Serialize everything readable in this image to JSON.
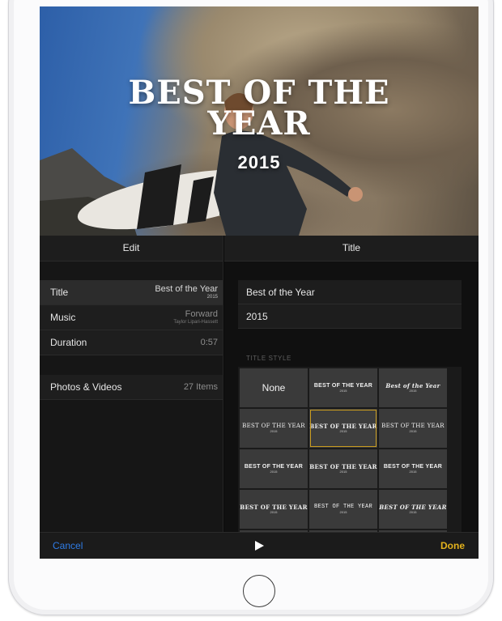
{
  "hero": {
    "title_line1": "BEST OF THE",
    "title_line2": "YEAR",
    "year": "2015"
  },
  "edit_panel": {
    "header": "Edit",
    "rows": [
      {
        "label": "Title",
        "value": "Best of the Year",
        "sub": "2015"
      },
      {
        "label": "Music",
        "value": "Forward",
        "sub": "Taylor Lipari-Hassett"
      },
      {
        "label": "Duration",
        "value": "0:57"
      }
    ],
    "photos": {
      "label": "Photos & Videos",
      "value": "27 Items"
    }
  },
  "title_panel": {
    "header": "Title",
    "title_field": "Best of the Year",
    "subtitle_field": "2015",
    "style_section_label": "TITLE STYLE",
    "styles": [
      {
        "line1": "None",
        "line2": ""
      },
      {
        "line1": "BEST OF THE YEAR",
        "line2": "2015"
      },
      {
        "line1": "Best of the Year",
        "line2": "2015"
      },
      {
        "line1": "BEST OF THE YEAR",
        "line2": "2015"
      },
      {
        "line1": "BEST OF THE YEAR",
        "line2": "2015"
      },
      {
        "line1": "BEST OF THE YEAR",
        "line2": "2015"
      },
      {
        "line1": "BEST OF THE YEAR",
        "line2": "2015"
      },
      {
        "line1": "BEST OF THE YEAR",
        "line2": "2015"
      },
      {
        "line1": "BEST OF THE YEAR",
        "line2": "2015"
      },
      {
        "line1": "BEST OF THE YEAR",
        "line2": "2015"
      },
      {
        "line1": "BEST OF THE YEAR",
        "line2": "2015"
      },
      {
        "line1": "BEST OF THE YEAR",
        "line2": "2015"
      }
    ]
  },
  "toolbar": {
    "cancel": "Cancel",
    "done": "Done",
    "play_icon": "play-icon"
  },
  "colors": {
    "accent_blue": "#2f7ce6",
    "accent_yellow": "#e3b21c",
    "selection_outline": "#c89b1e"
  }
}
